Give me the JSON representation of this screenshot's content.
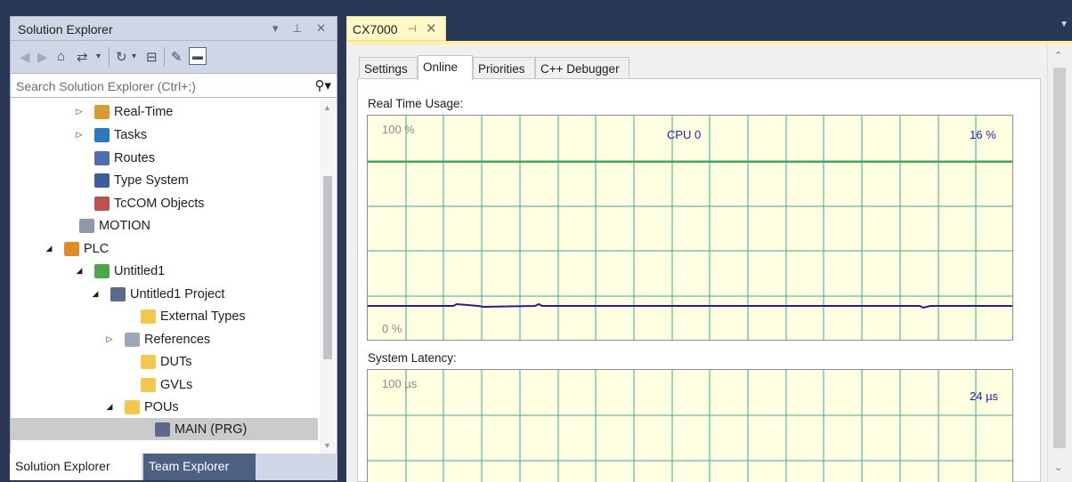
{
  "solution_explorer": {
    "title": "Solution Explorer",
    "title_buttons": "▾ ⊥ ✕",
    "search_placeholder": "Search Solution Explorer (Ctrl+;)",
    "tree": [
      {
        "label": "Real-Time",
        "icon": "realtime-icon",
        "color": "#d89a2a",
        "expanded": false,
        "has_children": true
      },
      {
        "label": "Tasks",
        "icon": "tasks-icon",
        "color": "#2a7ac0",
        "expanded": false,
        "has_children": true
      },
      {
        "label": "Routes",
        "icon": "routes-icon",
        "color": "#4f6db0",
        "has_children": false
      },
      {
        "label": "Type System",
        "icon": "type-system-icon",
        "color": "#3c5e9c",
        "has_children": false
      },
      {
        "label": "TcCOM Objects",
        "icon": "tccom-icon",
        "color": "#c0504d",
        "has_children": false
      },
      {
        "label": "MOTION",
        "icon": "motion-icon",
        "color": "#8f98a8",
        "has_children": false
      },
      {
        "label": "PLC",
        "icon": "plc-icon",
        "color": "#e28a24",
        "expanded": true,
        "has_children": true
      },
      {
        "label": "Untitled1",
        "icon": "plc-project-icon",
        "color": "#4aa845",
        "expanded": true,
        "has_children": true
      },
      {
        "label": "Untitled1 Project",
        "icon": "project-icon",
        "color": "#5a6a88",
        "expanded": true,
        "has_children": true
      },
      {
        "label": "External Types",
        "icon": "folder-icon",
        "color": "#f2c94c",
        "has_children": false
      },
      {
        "label": "References",
        "icon": "references-icon",
        "color": "#9ca7b8",
        "expanded": false,
        "has_children": true
      },
      {
        "label": "DUTs",
        "icon": "folder-icon",
        "color": "#f2c94c",
        "has_children": false
      },
      {
        "label": "GVLs",
        "icon": "folder-icon",
        "color": "#f2c94c",
        "has_children": false
      },
      {
        "label": "POUs",
        "icon": "folder-open-icon",
        "color": "#f2c94c",
        "expanded": true,
        "has_children": true
      },
      {
        "label": "MAIN (PRG)",
        "icon": "program-icon",
        "color": "#5a6a88",
        "has_children": false,
        "selected": true
      }
    ],
    "bottom_tabs": [
      "Solution Explorer",
      "Team Explorer"
    ]
  },
  "document": {
    "tab_title": "CX7000",
    "tabs": [
      "Settings",
      "Online",
      "Priorities",
      "C++ Debugger"
    ],
    "active_tab": "Online",
    "realtime": {
      "label": "Real Time Usage:",
      "top_scale": "100 %",
      "bottom_scale": "0 %",
      "series_label": "CPU 0",
      "current_value": "16 %",
      "limit_line_percent": 80,
      "usage_percent": 16,
      "line_color": "#2b16a8",
      "limit_color": "#3fae49"
    },
    "latency": {
      "label": "System Latency:",
      "top_scale": "100 µs",
      "current_value": "24 µs"
    }
  },
  "colors": {
    "grid": "#3fa79a",
    "graph_bg": "#ffffe1",
    "chrome": "#293955",
    "doc_tab": "#fff29d"
  }
}
